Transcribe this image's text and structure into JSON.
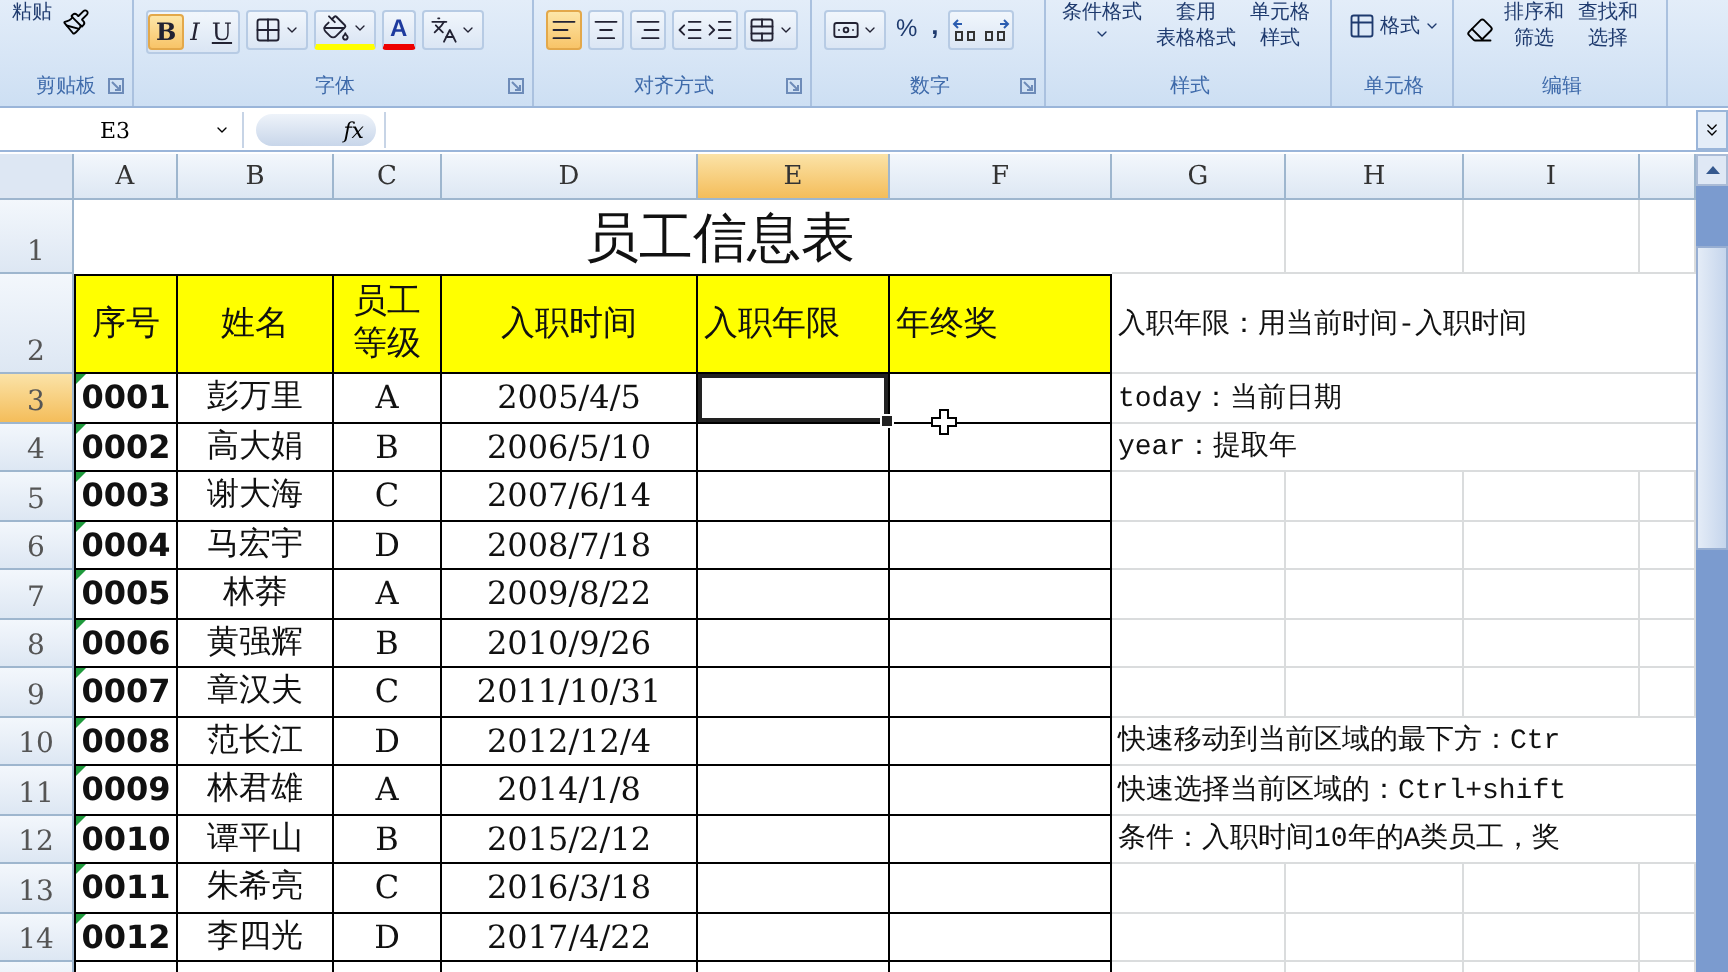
{
  "ribbon": {
    "clipboard": {
      "label": "剪贴板",
      "paste": "粘贴"
    },
    "font": {
      "label": "字体",
      "styles": [
        {
          "label": "B",
          "selected": true
        },
        {
          "label": "I",
          "selected": false
        },
        {
          "label": "U",
          "selected": false
        }
      ],
      "font_color": "A"
    },
    "alignment": {
      "label": "对齐方式",
      "aligns": [
        {
          "selected": true
        },
        {
          "selected": false
        },
        {
          "selected": false
        }
      ]
    },
    "number": {
      "label": "数字",
      "percent": "%",
      "comma": ","
    },
    "styles": {
      "label": "样式",
      "conditional": "条件格式",
      "table_format": [
        "套用",
        "表格格式"
      ],
      "cell_styles": [
        "单元格",
        "样式"
      ]
    },
    "cells": {
      "label": "单元格",
      "format": "格式"
    },
    "editing": {
      "label": "编辑",
      "sort": [
        "排序和",
        "筛选"
      ],
      "find": [
        "查找和",
        "选择"
      ]
    }
  },
  "formula_bar": {
    "name_box": "E3",
    "fx": "fx"
  },
  "columns": [
    {
      "label": "A",
      "selected": false
    },
    {
      "label": "B",
      "selected": false
    },
    {
      "label": "C",
      "selected": false
    },
    {
      "label": "D",
      "selected": false
    },
    {
      "label": "E",
      "selected": true
    },
    {
      "label": "F",
      "selected": false
    },
    {
      "label": "G",
      "selected": false
    },
    {
      "label": "H",
      "selected": false
    },
    {
      "label": "I",
      "selected": false
    }
  ],
  "rows": [
    {
      "number": "1",
      "selected": false,
      "kind": "title",
      "title": "员工信息表"
    },
    {
      "number": "2",
      "selected": false,
      "kind": "header",
      "cells": [
        "序号",
        "姓名",
        "员工等级",
        "入职时间",
        "入职年限",
        "年终奖"
      ],
      "note": "入职年限：用当前时间-入职时间"
    },
    {
      "number": "3",
      "selected": true,
      "kind": "data",
      "cells": [
        "0001",
        "彭万里",
        "A",
        "2005/4/5"
      ],
      "note": "today：当前日期"
    },
    {
      "number": "4",
      "selected": false,
      "kind": "data",
      "cells": [
        "0002",
        "高大娟",
        "B",
        "2006/5/10"
      ],
      "note": "year：提取年"
    },
    {
      "number": "5",
      "selected": false,
      "kind": "data",
      "cells": [
        "0003",
        "谢大海",
        "C",
        "2007/6/14"
      ]
    },
    {
      "number": "6",
      "selected": false,
      "kind": "data",
      "cells": [
        "0004",
        "马宏宇",
        "D",
        "2008/7/18"
      ]
    },
    {
      "number": "7",
      "selected": false,
      "kind": "data",
      "cells": [
        "0005",
        "林莽",
        "A",
        "2009/8/22"
      ]
    },
    {
      "number": "8",
      "selected": false,
      "kind": "data",
      "cells": [
        "0006",
        "黄强辉",
        "B",
        "2010/9/26"
      ]
    },
    {
      "number": "9",
      "selected": false,
      "kind": "data",
      "cells": [
        "0007",
        "章汉夫",
        "C",
        "2011/10/31"
      ]
    },
    {
      "number": "10",
      "selected": false,
      "kind": "data",
      "cells": [
        "0008",
        "范长江",
        "D",
        "2012/12/4"
      ],
      "note": "快速移动到当前区域的最下方：Ctr"
    },
    {
      "number": "11",
      "selected": false,
      "kind": "data",
      "cells": [
        "0009",
        "林君雄",
        "A",
        "2014/1/8"
      ],
      "note": "快速选择当前区域的：Ctrl+shift"
    },
    {
      "number": "12",
      "selected": false,
      "kind": "data",
      "cells": [
        "0010",
        "谭平山",
        "B",
        "2015/2/12"
      ],
      "note": "条件：入职时间10年的A类员工，奖"
    },
    {
      "number": "13",
      "selected": false,
      "kind": "data",
      "cells": [
        "0011",
        "朱希亮",
        "C",
        "2016/3/18"
      ]
    },
    {
      "number": "14",
      "selected": false,
      "kind": "data",
      "cells": [
        "0012",
        "李四光",
        "D",
        "2017/4/22"
      ]
    }
  ]
}
